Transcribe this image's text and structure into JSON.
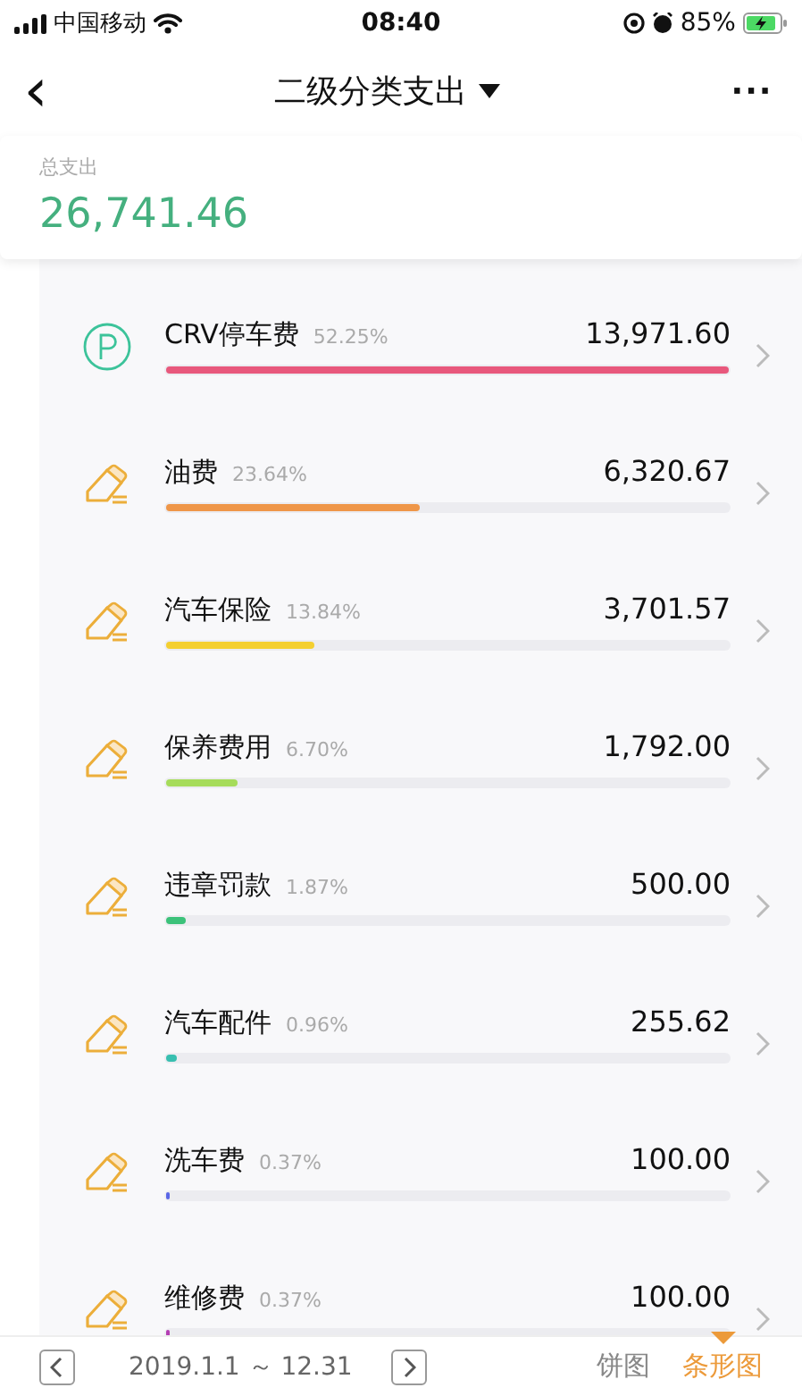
{
  "status_bar": {
    "carrier": "中国移动",
    "time": "08:40",
    "battery": "85%"
  },
  "nav": {
    "back": "‹",
    "title": "二级分类支出",
    "more": "···"
  },
  "summary": {
    "label": "总支出",
    "total": "26,741.46"
  },
  "items": [
    {
      "kind": "parking",
      "name": "CRV停车费",
      "percent": "52.25%",
      "amount": "13,971.60",
      "level": 1,
      "color": "#e8587c"
    },
    {
      "kind": "pencil",
      "name": "油费",
      "percent": "23.64%",
      "amount": "6,320.67",
      "level": 0.452,
      "color": "#ef9648"
    },
    {
      "kind": "pencil",
      "name": "汽车保险",
      "percent": "13.84%",
      "amount": "3,701.57",
      "level": 0.265,
      "color": "#f4cf30"
    },
    {
      "kind": "pencil",
      "name": "保养费用",
      "percent": "6.70%",
      "amount": "1,792.00",
      "level": 0.128,
      "color": "#a6dc5a"
    },
    {
      "kind": "pencil",
      "name": "违章罚款",
      "percent": "1.87%",
      "amount": "500.00",
      "level": 0.036,
      "color": "#3cc27a"
    },
    {
      "kind": "pencil",
      "name": "汽车配件",
      "percent": "0.96%",
      "amount": "255.62",
      "level": 0.018,
      "color": "#38bfb0"
    },
    {
      "kind": "pencil",
      "name": "洗车费",
      "percent": "0.37%",
      "amount": "100.00",
      "level": 0.007,
      "color": "#5a66e6"
    },
    {
      "kind": "pencil",
      "name": "维修费",
      "percent": "0.37%",
      "amount": "100.00",
      "level": 0.007,
      "color": "#b43fb4"
    }
  ],
  "footer": {
    "date_range": "2019.1.1 ～ 12.31",
    "tabs": [
      {
        "label": "饼图",
        "selected": false
      },
      {
        "label": "条形图",
        "selected": true
      }
    ]
  }
}
